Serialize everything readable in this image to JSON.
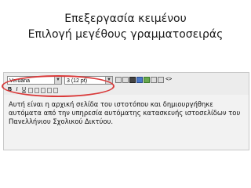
{
  "heading": {
    "line1": "Επεξεργασία κειμένου",
    "line2": "Επιλογή μεγέθους γραμματοσειράς"
  },
  "editor": {
    "font_select": {
      "value": "Verdana"
    },
    "size_select": {
      "value": "3 (12 pt)"
    },
    "toolbar_html_label": "<>",
    "content_lines": [
      "Αυτή είναι η αρχική σελίδα του ιστοτόπου και δημιουργήθηκε",
      "αυτόματα από την υπηρεσία αυτόματης κατασκευής ιστοσελίδων του",
      "Πανελλήνιου Σχολικού Δικτύου."
    ]
  },
  "colors": {
    "highlight": "#d93a3a"
  }
}
